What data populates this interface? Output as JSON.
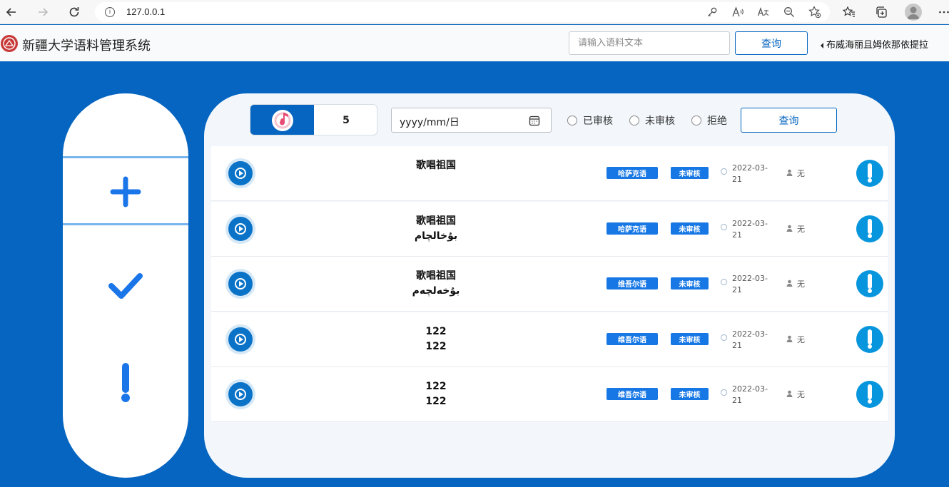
{
  "browser": {
    "url": "127.0.0.1"
  },
  "header": {
    "app_title": "新疆大学语料管理系统",
    "search_placeholder": "请输入语料文本",
    "query_label": "查询",
    "user_name": "布威海丽且姆依那依提拉"
  },
  "sidebar": {
    "items": [
      {
        "icon": "plus-icon"
      },
      {
        "icon": "check-icon"
      },
      {
        "icon": "exclamation-icon"
      }
    ],
    "accent_color": "#0565c0"
  },
  "filters": {
    "count": "5",
    "date_placeholder": "yyyy/mm/日",
    "radios": [
      "已审核",
      "未审核",
      "拒绝"
    ],
    "query_label": "查询"
  },
  "records": [
    {
      "text_lines": [
        "歌唱祖国",
        ""
      ],
      "language": "哈萨克语",
      "status": "未审核",
      "date_line1": "2022-03-",
      "date_line2": "21",
      "note": "无"
    },
    {
      "text_lines": [
        "歌唱祖国",
        "بۇخالچام"
      ],
      "language": "哈萨克语",
      "status": "未审核",
      "date_line1": "2022-03-",
      "date_line2": "21",
      "note": "无"
    },
    {
      "text_lines": [
        "歌唱祖国",
        "بۇخەلچەم"
      ],
      "language": "维吾尔语",
      "status": "未审核",
      "date_line1": "2022-03-",
      "date_line2": "21",
      "note": "无"
    },
    {
      "text_lines": [
        "122",
        "122"
      ],
      "language": "维吾尔语",
      "status": "未审核",
      "date_line1": "2022-03-",
      "date_line2": "21",
      "note": "无"
    },
    {
      "text_lines": [
        "122",
        "122"
      ],
      "language": "维吾尔语",
      "status": "未审核",
      "date_line1": "2022-03-",
      "date_line2": "21",
      "note": "无"
    }
  ]
}
